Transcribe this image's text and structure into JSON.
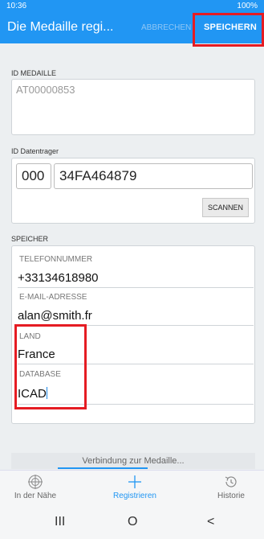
{
  "status_bar": {
    "time": "10:36",
    "right": "100%"
  },
  "appbar": {
    "title": "Die Medaille regi...",
    "cancel_label": "ABBRECHEN",
    "save_label": "SPEICHERN",
    "color": "#2196F3"
  },
  "medal": {
    "section_label": "ID MEDAILLE",
    "value": "AT00000853"
  },
  "carrier": {
    "section_label": "ID Datentrager",
    "prefix": "000",
    "code": "34FA464879",
    "scan_label": "SCANNEN"
  },
  "storage": {
    "section_label": "SPEICHER",
    "fields": [
      {
        "label": "TELEFONNUMMER",
        "value": "+33134618980"
      },
      {
        "label": "E-MAIL-ADRESSE",
        "value": "alan@smith.fr"
      },
      {
        "label": "LAND",
        "value": "France"
      },
      {
        "label": "DATABASE",
        "value": "ICAD"
      }
    ]
  },
  "toast": {
    "text": "Verbindung zur Medaille..."
  },
  "bottom_nav": [
    {
      "label": "In der Nähe",
      "icon": "nearby-icon",
      "active": false
    },
    {
      "label": "Registrieren",
      "icon": "plus-icon",
      "active": true
    },
    {
      "label": "Historie",
      "icon": "history-icon",
      "active": false
    }
  ],
  "system_nav": {
    "recents": "III",
    "home": "O",
    "back": "<"
  },
  "highlight_color": "#e51c23"
}
